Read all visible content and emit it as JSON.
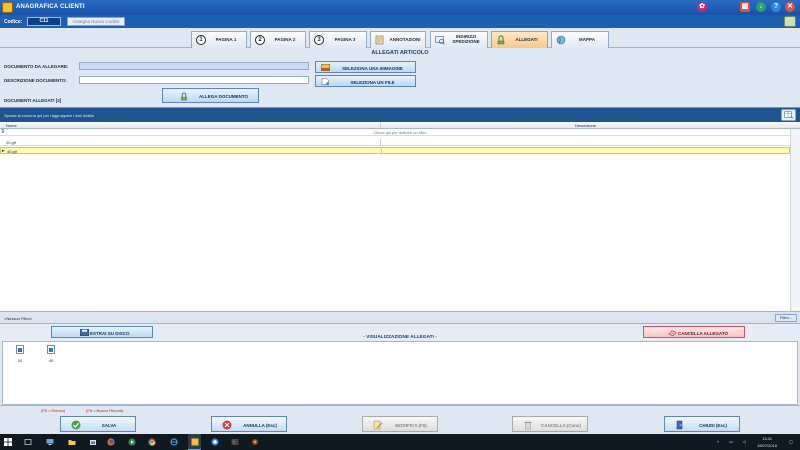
{
  "window": {
    "title": "ANAGRAFICA CLIENTI",
    "colors": {
      "titlebar": "#1852a8",
      "close": "#d9534f",
      "help": "#2b8ad6"
    }
  },
  "codebar": {
    "code_label": "Codice",
    "code_value": "C11",
    "assign_label": "Assegna Nuovo Codice"
  },
  "tabs": [
    {
      "label": "PAGINA 1",
      "icon": "number-1-icon"
    },
    {
      "label": "PAGINA 2",
      "icon": "number-2-icon"
    },
    {
      "label": "PAGINA 3",
      "icon": "number-3-icon"
    },
    {
      "label": "ANNOTAZIONI",
      "icon": "notes-icon"
    },
    {
      "label": "INDIRIZZI SPEDIZIONE",
      "icon": "address-icon"
    },
    {
      "label": "ALLEGATI",
      "icon": "attachment-icon",
      "active": true
    },
    {
      "label": "MAPPA",
      "icon": "globe-icon"
    }
  ],
  "form": {
    "title": "ALLEGATI ARTICOLO",
    "document_label": "DOCUMENTO DA ALLEGARE:",
    "document_value": "",
    "description_label": "DESCRIZIONE DOCUMENTO:",
    "description_value": "",
    "select_image_label": "SELEZIONA UNA IMMAGINE",
    "select_file_label": "SELEZIONA UN FILE",
    "attach_label": "ALLEGA DOCUMENTO"
  },
  "documents": {
    "label": "DOCUMENTI ALLEGATI [2]",
    "group_hint": "Sposta la colonna qui per raggruppare i dati relativi",
    "columns": [
      "Nome",
      "Descrizione"
    ],
    "filter_hint": "Clicca qui per definire un filtro",
    "rows": [
      {
        "name": "20.gif",
        "description": ""
      },
      {
        "name": "40.gif",
        "description": "",
        "selected": true
      }
    ],
    "filter_status": "<Nessun Filtro>",
    "filter_button": "Filtro..."
  },
  "preview": {
    "extract_label": "ESTRAI SU DISCO",
    "title": "- VISUALIZZAZIONE ALLEGATI -",
    "delete_label": "CANCELLA ALLEGATO",
    "thumbnails": [
      {
        "label": "20"
      },
      {
        "label": "40"
      }
    ]
  },
  "bottom": {
    "shortcut_list": "(F5 = Elenco)",
    "shortcut_new": "(F8 = Nuovo Record)",
    "save_label": "SALVA",
    "cancel_label": "ANNULLA (Esc)",
    "edit_label": "MODIFICA (F9)",
    "delete_label": "CANCELLA (Canc)",
    "close_label": "CHIUDI (Esc)"
  },
  "taskbar": {
    "time": "13:41",
    "date": "19/07/2016"
  }
}
